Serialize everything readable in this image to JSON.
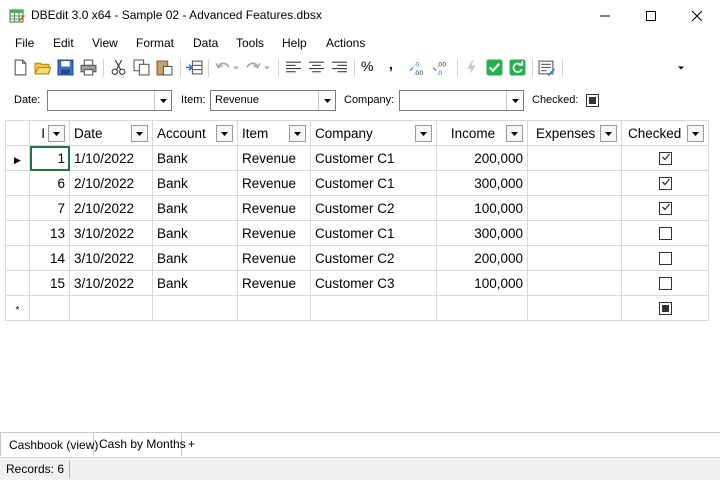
{
  "window": {
    "title": "DBEdit 3.0 x64 - Sample 02 - Advanced Features.dbsx",
    "app_icon": "table-grid-icon"
  },
  "menu": {
    "items": [
      "File",
      "Edit",
      "View",
      "Format",
      "Data",
      "Tools",
      "Help",
      "Actions"
    ]
  },
  "toolbar": {
    "icons": [
      "new-icon",
      "open-icon",
      "save-icon",
      "print-icon",
      "cut-icon",
      "copy-icon",
      "paste-icon",
      "insert-row-icon",
      "undo-icon",
      "redo-icon",
      "align-left-icon",
      "align-center-icon",
      "align-right-icon",
      "percent-icon",
      "thousands-separator-icon",
      "increase-decimal-icon",
      "decrease-decimal-icon",
      "lightning-icon",
      "check-icon",
      "refresh-icon",
      "properties-icon",
      "overflow-icon"
    ],
    "percent_glyph": "%",
    "comma_glyph": ","
  },
  "filters": {
    "date_label": "Date:",
    "date_value": "",
    "item_label": "Item:",
    "item_value": "Revenue",
    "company_label": "Company:",
    "company_value": "",
    "checked_label": "Checked:",
    "checked_state": "indeterminate"
  },
  "grid": {
    "columns": [
      "I",
      "Date",
      "Account",
      "Item",
      "Company",
      "Income",
      "Expenses",
      "Checked"
    ],
    "rows": [
      {
        "id": "1",
        "date": "1/10/2022",
        "account": "Bank",
        "item": "Revenue",
        "company": "Customer C1",
        "income": "200,000",
        "expenses": "",
        "checked": true
      },
      {
        "id": "6",
        "date": "2/10/2022",
        "account": "Bank",
        "item": "Revenue",
        "company": "Customer C1",
        "income": "300,000",
        "expenses": "",
        "checked": true
      },
      {
        "id": "7",
        "date": "2/10/2022",
        "account": "Bank",
        "item": "Revenue",
        "company": "Customer C2",
        "income": "100,000",
        "expenses": "",
        "checked": true
      },
      {
        "id": "13",
        "date": "3/10/2022",
        "account": "Bank",
        "item": "Revenue",
        "company": "Customer C1",
        "income": "300,000",
        "expenses": "",
        "checked": false
      },
      {
        "id": "14",
        "date": "3/10/2022",
        "account": "Bank",
        "item": "Revenue",
        "company": "Customer C2",
        "income": "200,000",
        "expenses": "",
        "checked": false
      },
      {
        "id": "15",
        "date": "3/10/2022",
        "account": "Bank",
        "item": "Revenue",
        "company": "Customer C3",
        "income": "100,000",
        "expenses": "",
        "checked": false
      }
    ],
    "current_row_glyph": "▶",
    "new_row_glyph": "*",
    "new_row_checked": "indeterminate"
  },
  "tabs": {
    "items": [
      "Cashbook (view)",
      "Cash by Months"
    ],
    "add_glyph": "+",
    "active": "Cashbook (view)"
  },
  "status": {
    "records_label": "Records:",
    "records_value": "6"
  },
  "colors": {
    "accent_green": "#217346",
    "check_green": "#22b14c",
    "grid_line": "#d9d9d9"
  }
}
